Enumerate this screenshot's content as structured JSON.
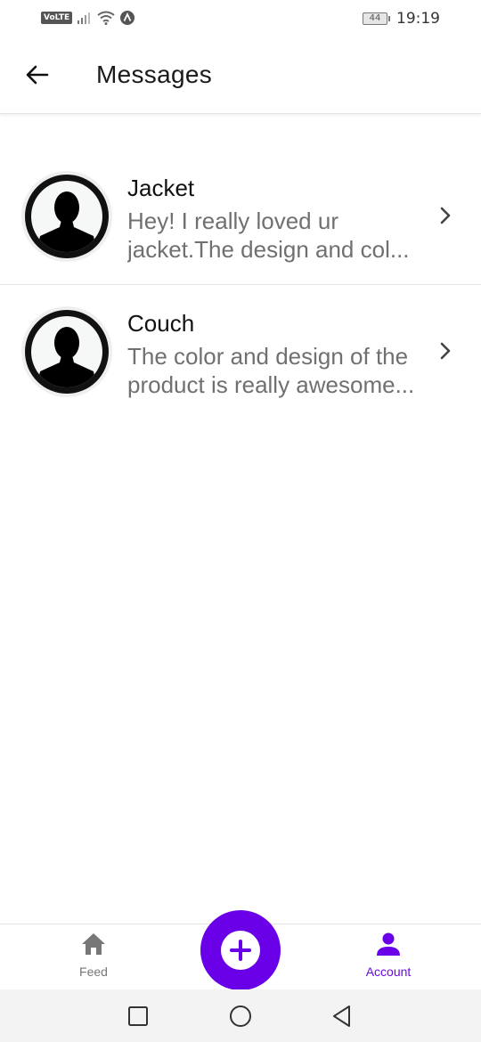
{
  "status_bar": {
    "network_label": "VoLTE",
    "battery_level": "44",
    "time": "19:19"
  },
  "header": {
    "title": "Messages",
    "back_icon": "arrow-left-icon"
  },
  "messages": [
    {
      "title": "Jacket",
      "preview_line1": "Hey! I really loved ur",
      "preview_line2": "jacket.The design and col..."
    },
    {
      "title": "Couch",
      "preview_line1": "The color and design of the",
      "preview_line2": "product is really awesome..."
    }
  ],
  "bottom_nav": {
    "feed_label": "Feed",
    "account_label": "Account",
    "fab_icon": "plus-icon",
    "active_item": "Account"
  },
  "colors": {
    "accent": "#6a00e8",
    "inactive": "#777777",
    "preview_text": "#707070"
  }
}
